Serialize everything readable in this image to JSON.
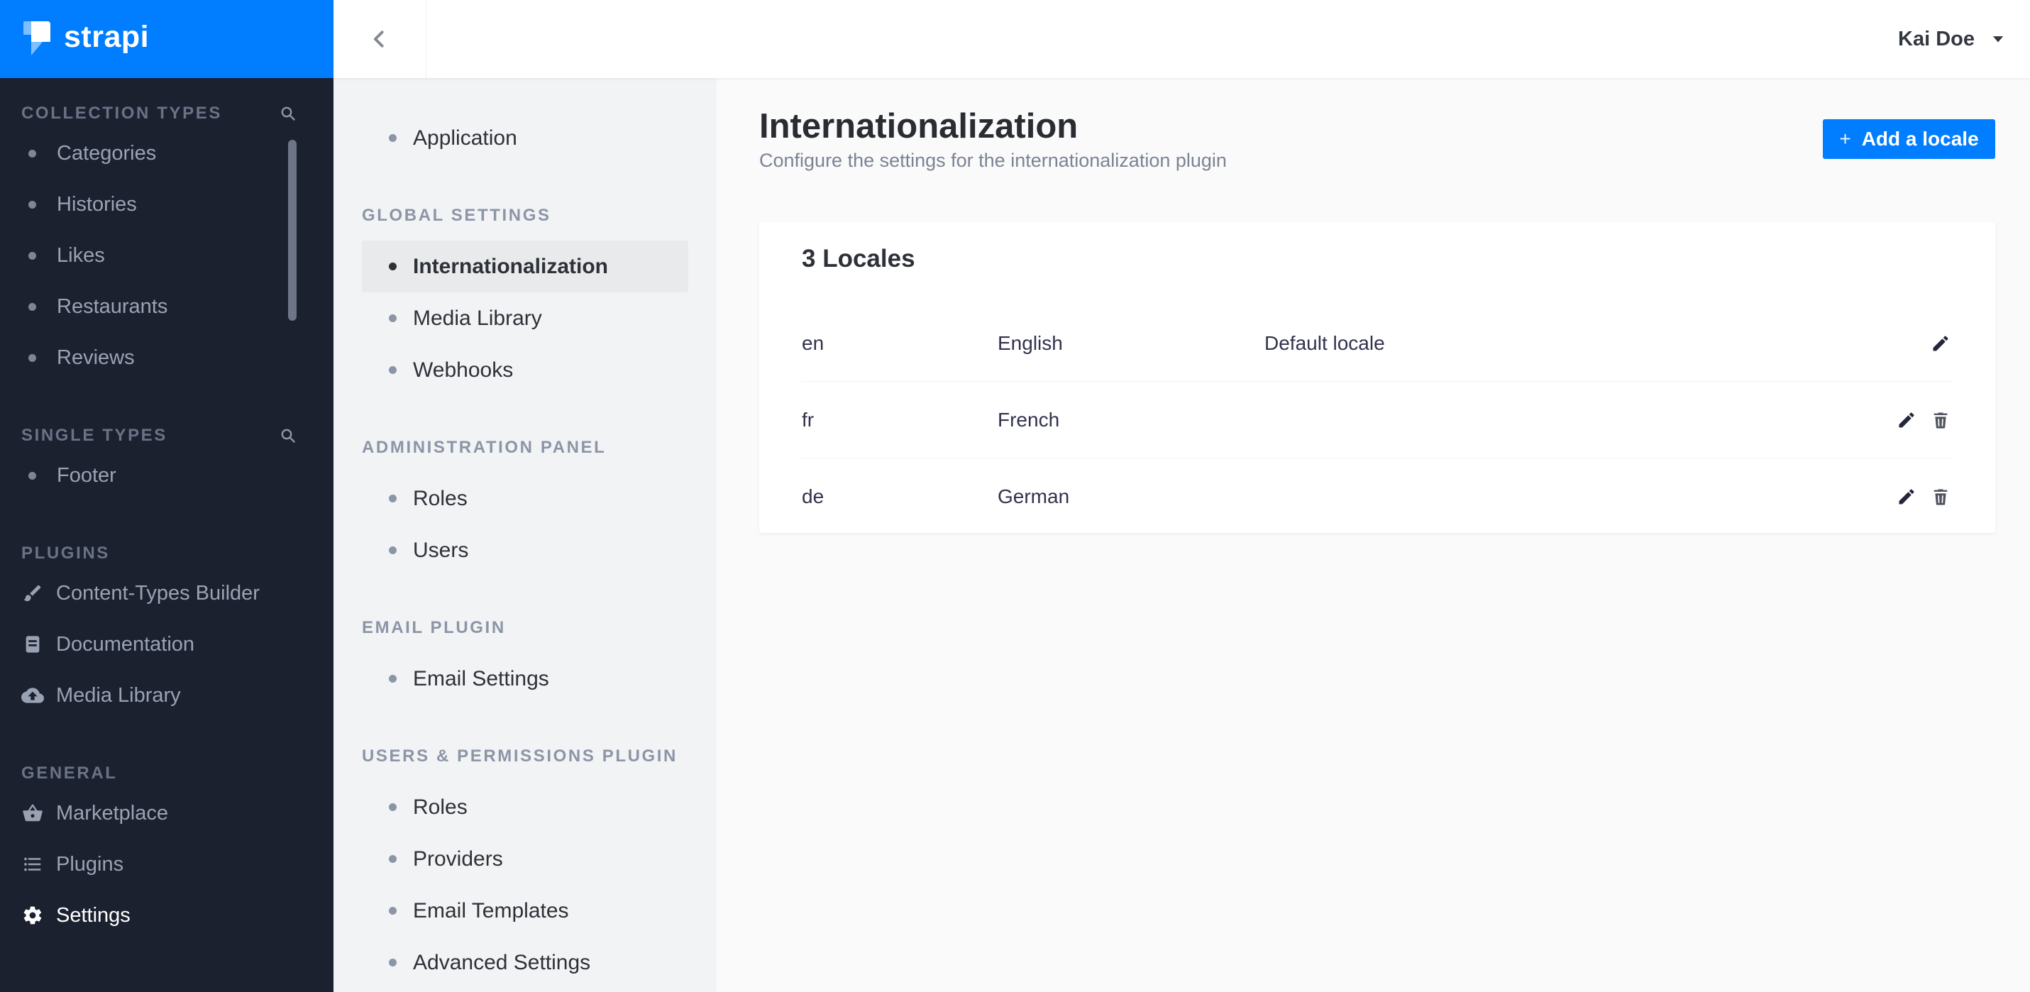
{
  "brand": {
    "name": "strapi"
  },
  "topbar": {
    "user_name": "Kai Doe"
  },
  "colors": {
    "accent": "#007eff",
    "sidebar_dark": "#1c2130",
    "sidebar_light": "#f2f3f4",
    "content_bg": "#fafafb"
  },
  "main_sidebar": {
    "sections": [
      {
        "title": "COLLECTION TYPES",
        "has_search": true,
        "items": [
          {
            "label": "Categories"
          },
          {
            "label": "Histories"
          },
          {
            "label": "Likes"
          },
          {
            "label": "Restaurants"
          },
          {
            "label": "Reviews"
          }
        ]
      },
      {
        "title": "SINGLE TYPES",
        "has_search": true,
        "items": [
          {
            "label": "Footer"
          }
        ]
      },
      {
        "title": "PLUGINS",
        "has_search": false,
        "items": [
          {
            "label": "Content-Types Builder",
            "icon": "brush"
          },
          {
            "label": "Documentation",
            "icon": "book"
          },
          {
            "label": "Media Library",
            "icon": "cloud-upload"
          }
        ]
      },
      {
        "title": "GENERAL",
        "has_search": false,
        "items": [
          {
            "label": "Marketplace",
            "icon": "basket"
          },
          {
            "label": "Plugins",
            "icon": "list"
          },
          {
            "label": "Settings",
            "icon": "gear",
            "active": true
          }
        ]
      }
    ]
  },
  "settings_sidebar": {
    "top_item": {
      "label": "Application"
    },
    "sections": [
      {
        "title": "GLOBAL SETTINGS",
        "items": [
          {
            "label": "Internationalization",
            "selected": true
          },
          {
            "label": "Media Library"
          },
          {
            "label": "Webhooks"
          }
        ]
      },
      {
        "title": "ADMINISTRATION PANEL",
        "items": [
          {
            "label": "Roles"
          },
          {
            "label": "Users"
          }
        ]
      },
      {
        "title": "EMAIL PLUGIN",
        "items": [
          {
            "label": "Email Settings"
          }
        ]
      },
      {
        "title": "USERS & PERMISSIONS PLUGIN",
        "items": [
          {
            "label": "Roles"
          },
          {
            "label": "Providers"
          },
          {
            "label": "Email Templates"
          },
          {
            "label": "Advanced Settings"
          }
        ]
      }
    ]
  },
  "page": {
    "title": "Internationalization",
    "subtitle": "Configure the settings for the internationalization plugin",
    "add_button_label": "Add a locale",
    "add_button_plus": "+",
    "card": {
      "heading": "3 Locales",
      "rows": [
        {
          "code": "en",
          "name": "English",
          "note": "Default locale"
        },
        {
          "code": "fr",
          "name": "French",
          "note": ""
        },
        {
          "code": "de",
          "name": "German",
          "note": ""
        }
      ]
    }
  }
}
